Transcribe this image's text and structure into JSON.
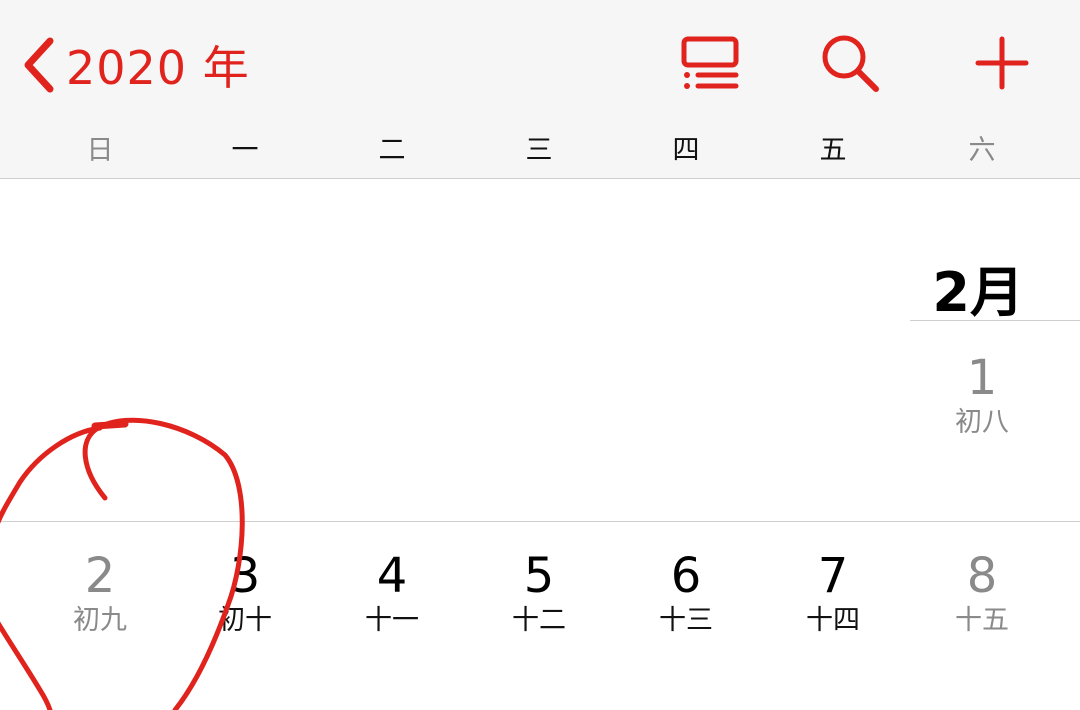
{
  "header": {
    "back_label": "2020 年",
    "colors": {
      "accent": "#e1231e"
    },
    "tools": [
      {
        "name": "list-view-icon"
      },
      {
        "name": "search-icon"
      },
      {
        "name": "add-icon"
      }
    ]
  },
  "weekdays": [
    "日",
    "一",
    "二",
    "三",
    "四",
    "五",
    "六"
  ],
  "month": {
    "label": "2月"
  },
  "first_day": {
    "number": "1",
    "lunar": "初八"
  },
  "week2": [
    {
      "number": "2",
      "lunar": "初九"
    },
    {
      "number": "3",
      "lunar": "初十"
    },
    {
      "number": "4",
      "lunar": "十一"
    },
    {
      "number": "5",
      "lunar": "十二"
    },
    {
      "number": "6",
      "lunar": "十三"
    },
    {
      "number": "7",
      "lunar": "十四"
    },
    {
      "number": "8",
      "lunar": "十五"
    }
  ],
  "annotation": {
    "color": "#e1231e",
    "shape": "hand-drawn circle around Sunday the 2nd"
  }
}
